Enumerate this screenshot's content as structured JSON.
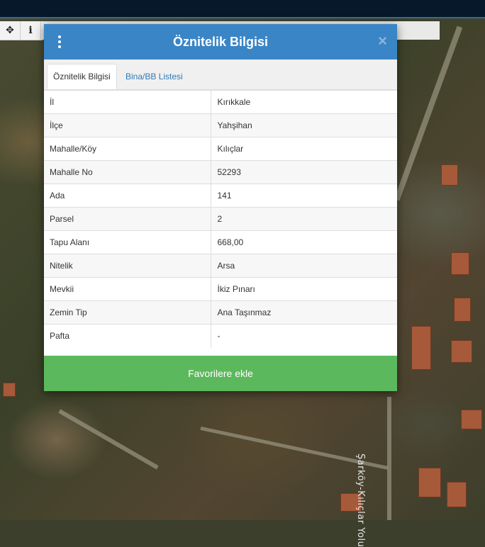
{
  "toolbar": {
    "move_icon": "move-icon",
    "info_icon": "info-icon",
    "move_glyph": "✥",
    "info_glyph": "i"
  },
  "map": {
    "road_label": "Şarköy-Kılıçlar Yolu"
  },
  "modal": {
    "title": "Öznitelik Bilgisi",
    "close_glyph": "×",
    "tabs": [
      {
        "label": "Öznitelik Bilgisi",
        "active": true
      },
      {
        "label": "Bina/BB Listesi",
        "active": false
      }
    ],
    "rows": [
      {
        "key": "İl",
        "value": "Kırıkkale"
      },
      {
        "key": "İlçe",
        "value": "Yahşihan"
      },
      {
        "key": "Mahalle/Köy",
        "value": "Kılıçlar"
      },
      {
        "key": "Mahalle No",
        "value": "52293"
      },
      {
        "key": "Ada",
        "value": "141"
      },
      {
        "key": "Parsel",
        "value": "2"
      },
      {
        "key": "Tapu Alanı",
        "value": "668,00"
      },
      {
        "key": "Nitelik",
        "value": "Arsa"
      },
      {
        "key": "Mevkii",
        "value": "İkiz Pınarı"
      },
      {
        "key": "Zemin Tip",
        "value": "Ana Taşınmaz"
      },
      {
        "key": "Pafta",
        "value": "-"
      }
    ],
    "favorite_button": "Favorilere ekle"
  },
  "colors": {
    "header": "#3a85c6",
    "favorite": "#5cb85c",
    "topbar": "#07182a"
  }
}
